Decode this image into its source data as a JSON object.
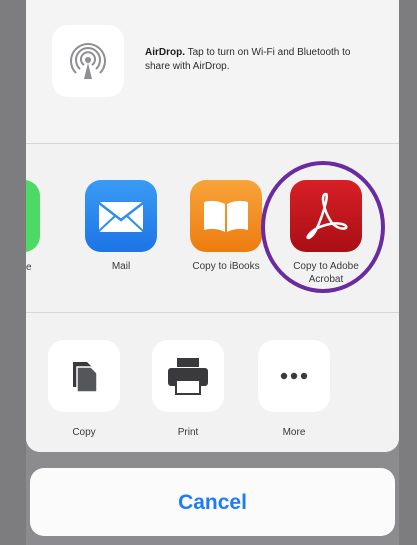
{
  "airdrop": {
    "title": "AirDrop.",
    "description": " Tap to turn on Wi-Fi and Bluetooth to share with AirDrop.",
    "icon": "airdrop-icon"
  },
  "apps": {
    "partial_label": "e",
    "partial_color": "#4cd964",
    "items": [
      {
        "label": "Mail",
        "icon": "mail-icon",
        "color": "#2f8ef0"
      },
      {
        "label": "Copy to iBooks",
        "icon": "ibooks-icon",
        "color": "#f08a17"
      },
      {
        "label": "Copy to Adobe Acrobat",
        "icon": "adobe-acrobat-icon",
        "color": "#c3121c"
      }
    ]
  },
  "actions": {
    "items": [
      {
        "label": "Copy",
        "icon": "copy-icon"
      },
      {
        "label": "Print",
        "icon": "print-icon"
      },
      {
        "label": "More",
        "icon": "more-icon"
      }
    ]
  },
  "cancel_label": "Cancel",
  "highlight_color": "#6a2aa0",
  "accent_color": "#1f7cf6"
}
